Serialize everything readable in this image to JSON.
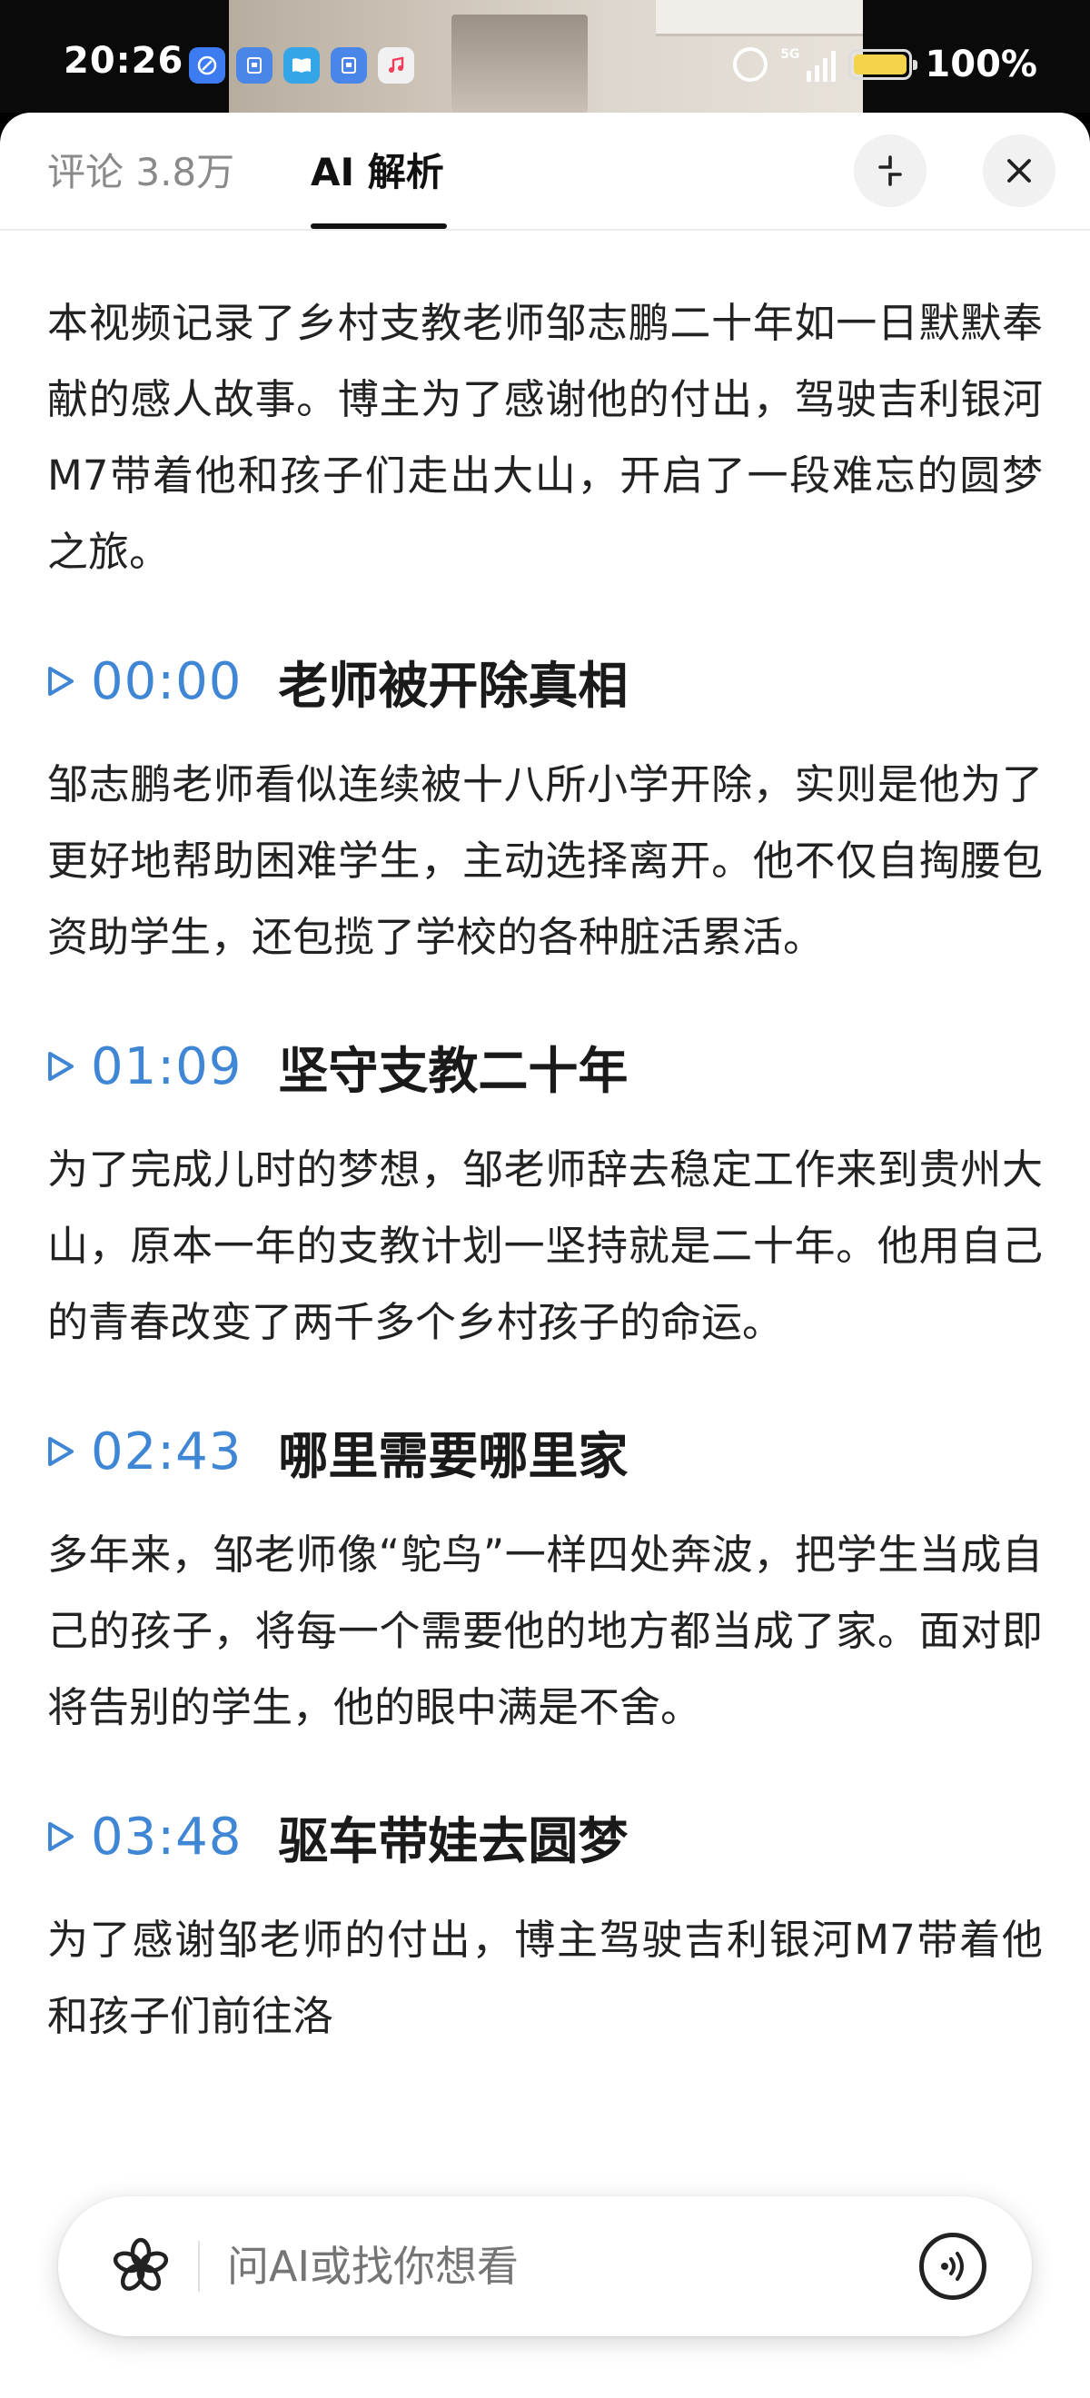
{
  "status_bar": {
    "time": "20:26",
    "network": "5G",
    "battery_text": "100%",
    "app_icons": [
      "browser-icon",
      "wallet-icon",
      "reader-icon",
      "wallet-icon",
      "music-icon"
    ]
  },
  "tabs": [
    {
      "label": "评论 3.8万",
      "active": false
    },
    {
      "label": "AI 解析",
      "active": true
    }
  ],
  "summary": "本视频记录了乡村支教老师邹志鹏二十年如一日默默奉献的感人故事。博主为了感谢他的付出，驾驶吉利银河M7带着他和孩子们走出大山，开启了一段难忘的圆梦之旅。",
  "sections": [
    {
      "time": "00:00",
      "title": "老师被开除真相",
      "text": "邹志鹏老师看似连续被十八所小学开除，实则是他为了更好地帮助困难学生，主动选择离开。他不仅自掏腰包资助学生，还包揽了学校的各种脏活累活。"
    },
    {
      "time": "01:09",
      "title": "坚守支教二十年",
      "text": "为了完成儿时的梦想，邹老师辞去稳定工作来到贵州大山，原本一年的支教计划一坚持就是二十年。他用自己的青春改变了两千多个乡村孩子的命运。"
    },
    {
      "time": "02:43",
      "title": "哪里需要哪里家",
      "text": "多年来，邹老师像“鸵鸟”一样四处奔波，把学生当成自己的孩子，将每一个需要他的地方都当成了家。面对即将告别的学生，他的眼中满是不舍。"
    },
    {
      "time": "03:48",
      "title": "驱车带娃去圆梦",
      "text": "为了感谢邹老师的付出，博主驾驶吉利银河M7带着他和孩子们前往洛"
    }
  ],
  "ask_bar": {
    "placeholder": "问AI或找你想看"
  },
  "colors": {
    "accent": "#3f86d4",
    "text": "#222222",
    "tab_inactive": "#8a8a8a"
  }
}
